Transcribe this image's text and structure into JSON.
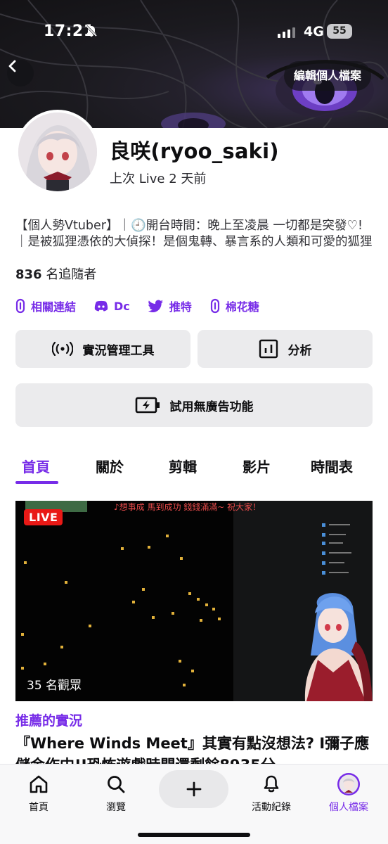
{
  "status_bar": {
    "time": "17:21",
    "network": "4G",
    "battery": "55"
  },
  "header": {
    "edit_profile_label": "編輯個人檔案"
  },
  "profile": {
    "channel_name": "良咲(ryoo_saki)",
    "last_live": "上次 Live 2 天前",
    "bio": "【個人勢Vtuber】｜🕘開台時間：晚上至凌晨 一切都是突發♡!｜是被狐狸憑依的大偵探！是個鬼轉、暴言系的人類和可愛的狐狸",
    "followers_count": "836",
    "followers_label": "名追隨者"
  },
  "links": [
    {
      "icon": "link-icon",
      "label": "相關連結"
    },
    {
      "icon": "discord-icon",
      "label": "Dc"
    },
    {
      "icon": "twitter-icon",
      "label": "推特"
    },
    {
      "icon": "link-icon",
      "label": "棉花糖"
    }
  ],
  "actions": {
    "stream_manager": "實況管理工具",
    "analytics": "分析",
    "ad_free_trial": "試用無廣告功能"
  },
  "tabs": [
    "首頁",
    "關於",
    "剪輯",
    "影片",
    "時間表"
  ],
  "active_tab": "首頁",
  "live_card": {
    "badge": "LIVE",
    "viewers": "35 名觀眾",
    "ticker_text": "♪想事成 馬到成功 錢錢滿滿~ 祝大家！",
    "section_label": "推薦的實況",
    "title": "『Where Winds Meet』其實有點沒想法? I彌子應儲金作中!I恐怖遊戲時間還剩餘8935分"
  },
  "bottom_nav": [
    {
      "icon": "home-icon",
      "label": "首頁"
    },
    {
      "icon": "search-icon",
      "label": "瀏覽"
    },
    {
      "icon": "plus-icon",
      "label": ""
    },
    {
      "icon": "bell-icon",
      "label": "活動紀錄"
    },
    {
      "icon": "profile-avatar-icon",
      "label": "個人檔案"
    }
  ],
  "colors": {
    "accent": "#772ce8",
    "live_red": "#e91916"
  }
}
